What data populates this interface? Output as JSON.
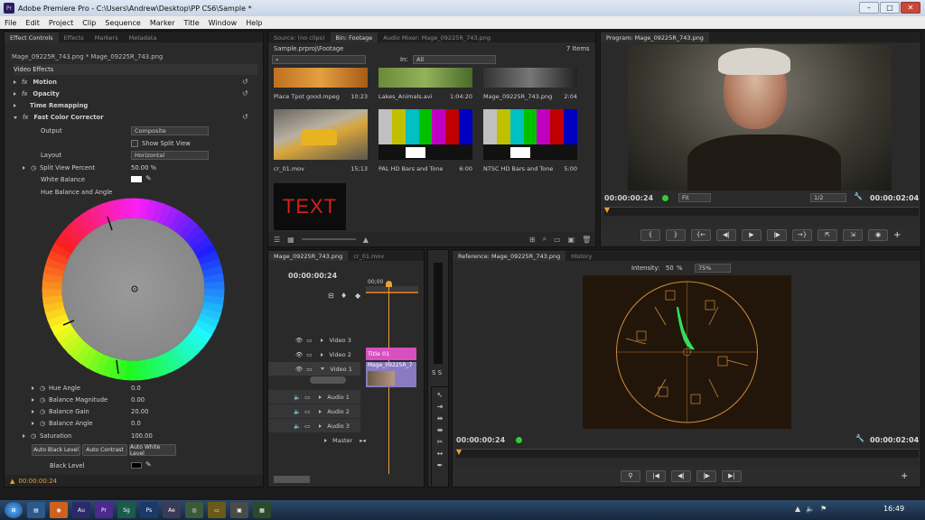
{
  "window": {
    "title": "Adobe Premiere Pro - C:\\Users\\Andrew\\Desktop\\PP CS6\\Sample *",
    "minimize": "–",
    "maximize": "□",
    "close": "✕"
  },
  "menu": [
    "File",
    "Edit",
    "Project",
    "Clip",
    "Sequence",
    "Marker",
    "Title",
    "Window",
    "Help"
  ],
  "effect_controls": {
    "tabs": [
      "Effect Controls",
      "Effects",
      "Markers",
      "Metadata"
    ],
    "clip_path": "Mage_09225R_743.png * Mage_09225R_743.png",
    "section": "Video Effects",
    "effects": [
      "Motion",
      "Opacity",
      "Time Remapping",
      "Fast Color Corrector"
    ],
    "output_label": "Output",
    "output_value": "Composite",
    "show_split": "Show Split View",
    "layout_label": "Layout",
    "layout_value": "Horizontal",
    "split_label": "Split View Percent",
    "split_value": "50.00 %",
    "white_balance": "White Balance",
    "hue_label": "Hue Balance and Angle",
    "hue_angle": "Hue Angle",
    "hue_angle_value": "0.0",
    "bal_mag": "Balance Magnitude",
    "bal_mag_value": "0.00",
    "bal_gain": "Balance Gain",
    "bal_gain_value": "20.00",
    "bal_angle": "Balance Angle",
    "bal_angle_value": "0.0",
    "saturation": "Saturation",
    "saturation_value": "100.00",
    "auto_black": "Auto Black Level",
    "auto_contrast": "Auto Contrast",
    "auto_white": "Auto White Level",
    "black_level": "Black Level",
    "timecode": "00:00:00:24"
  },
  "project": {
    "tabs": [
      "Source: (no clips)",
      "Bin: Footage",
      "Audio Mixer: Mage_09225R_743.png"
    ],
    "path": "Sample.prproj\\Footage",
    "items": "7 Items",
    "in_label": "In:",
    "in_value": "All",
    "clips": [
      {
        "name": "Place Tpot good.mpeg",
        "dur": "10:23"
      },
      {
        "name": "Lakes_Animals.avi",
        "dur": "1:04:20"
      },
      {
        "name": "Mage_09225R_743.png",
        "dur": "2:04"
      },
      {
        "name": "cr_01.mov",
        "dur": "15;13"
      },
      {
        "name": "PAL HD Bars and Tone",
        "dur": "6:00"
      },
      {
        "name": "NTSC HD Bars and Tone",
        "dur": "5:00"
      }
    ],
    "text_thumb": "TEXT"
  },
  "program": {
    "tab": "Program: Mage_09225R_743.png",
    "timecode": "00:00:00:24",
    "fit": "Fit",
    "res": "1/2",
    "duration": "00:00:02:04"
  },
  "timeline": {
    "tabs": [
      "Mage_09225R_743.png",
      "cr_01.mov"
    ],
    "timecode": "00:00:00:24",
    "ruler": "00;00",
    "tracks": [
      "Video 3",
      "Video 2",
      "Video 1",
      "Audio 1",
      "Audio 2",
      "Audio 3",
      "Master"
    ],
    "clip_title": "Title 01",
    "clip_v1": "Mage_09225R_7"
  },
  "reference": {
    "tabs": [
      "Reference: Mage_09225R_743.png",
      "History"
    ],
    "intensity_label": "Intensity:",
    "intensity_value": "50",
    "pct": "%",
    "zoom": "75%",
    "timecode": "00:00:00:24",
    "duration": "00:00:02:04"
  },
  "taskbar": {
    "clock": "16:49"
  }
}
